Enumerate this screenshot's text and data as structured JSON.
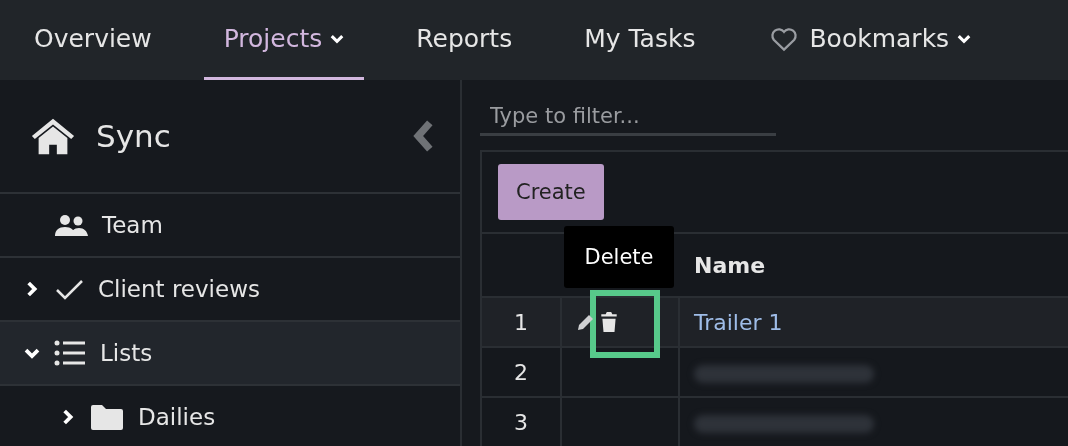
{
  "nav": [
    {
      "label": "Overview",
      "selected": false,
      "dropdown": false,
      "kind": "link"
    },
    {
      "label": "Projects",
      "selected": true,
      "dropdown": true,
      "kind": "link"
    },
    {
      "label": "Reports",
      "selected": false,
      "dropdown": false,
      "kind": "link"
    },
    {
      "label": "My Tasks",
      "selected": false,
      "dropdown": false,
      "kind": "link"
    },
    {
      "label": "Bookmarks",
      "selected": false,
      "dropdown": true,
      "kind": "favorites"
    }
  ],
  "sidebar": {
    "title": "Sync",
    "items": [
      {
        "label": "Team",
        "kind": "team",
        "selected": false
      },
      {
        "label": "Client reviews",
        "kind": "review",
        "selected": false,
        "expanded": false
      },
      {
        "label": "Lists",
        "kind": "list",
        "selected": true,
        "expanded": true,
        "children": [
          {
            "label": "Dailies",
            "kind": "folder",
            "selected": false,
            "expanded": false
          }
        ]
      }
    ]
  },
  "filter": {
    "placeholder": "Type to filter..."
  },
  "create_button": "Create",
  "table": {
    "columns": [
      "Name"
    ],
    "tooltip": "Delete",
    "rows": [
      {
        "number": "1",
        "name": "Trailer 1",
        "selected": true
      },
      {
        "number": "2",
        "selected": false
      },
      {
        "number": "3",
        "selected": false
      }
    ]
  }
}
